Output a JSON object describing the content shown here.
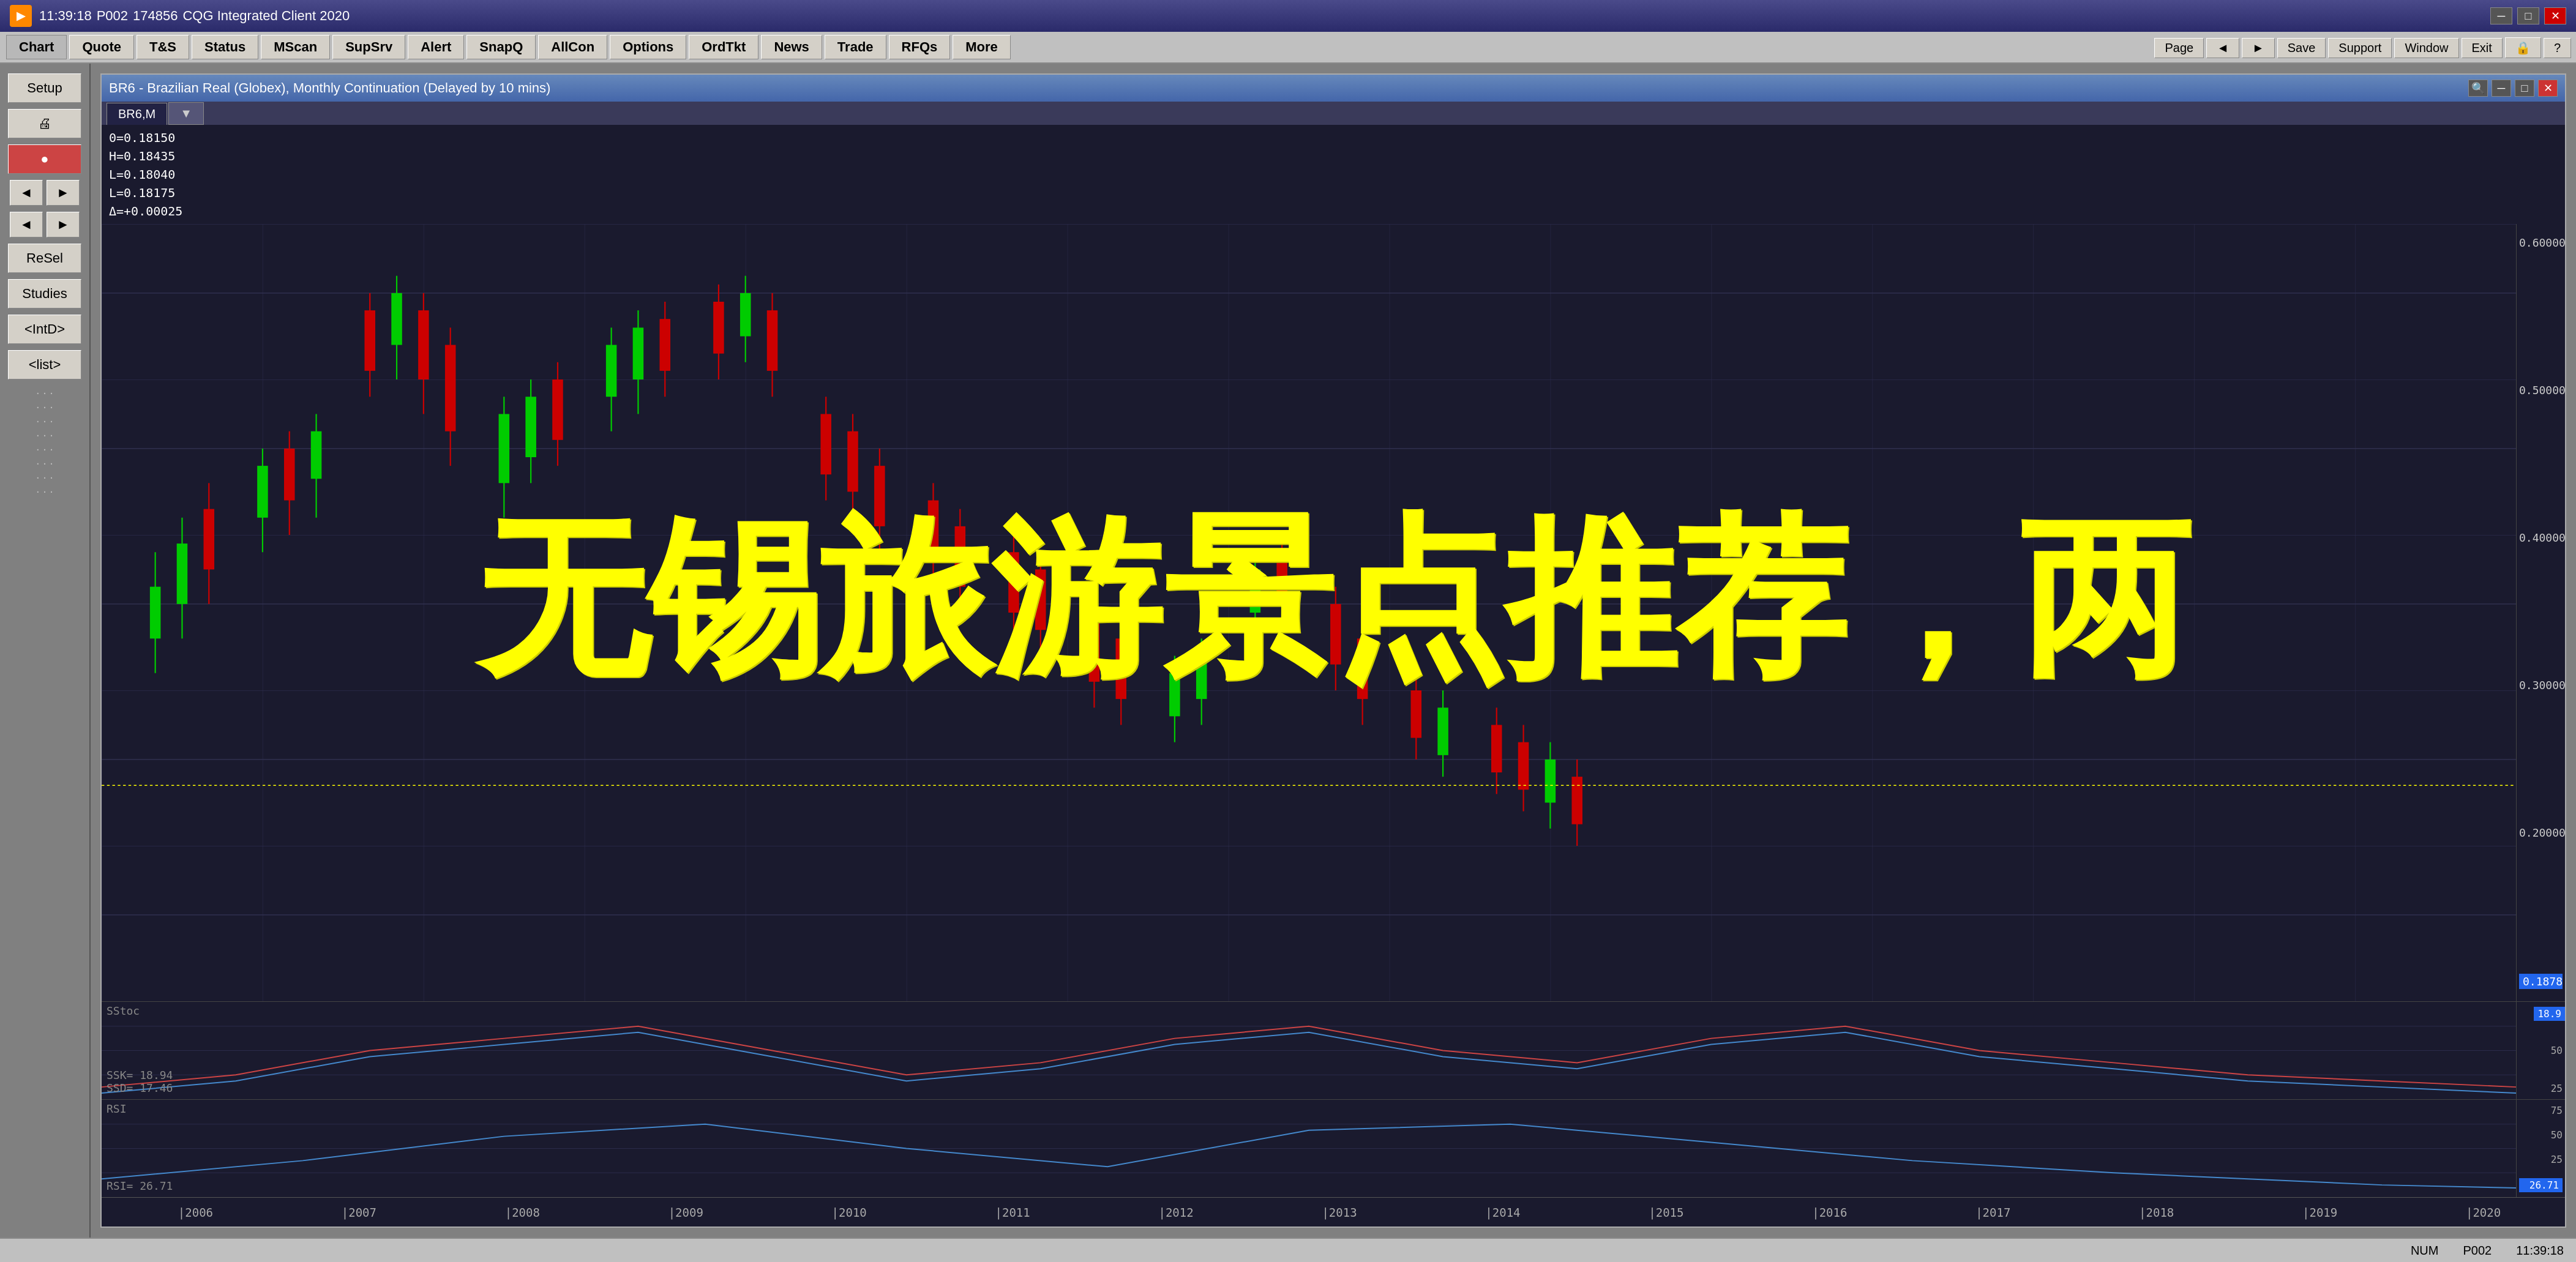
{
  "titlebar": {
    "icon_text": "▶",
    "time": "11:39:18",
    "account": "P002",
    "build": "174856",
    "app_name": "CQG Integrated Client 2020",
    "minimize": "─",
    "maximize": "□",
    "close": "✕"
  },
  "menubar": {
    "items": [
      {
        "label": "Chart",
        "active": true
      },
      {
        "label": "Quote"
      },
      {
        "label": "T&S"
      },
      {
        "label": "Status"
      },
      {
        "label": "MScan"
      },
      {
        "label": "SupSrv"
      },
      {
        "label": "Alert"
      },
      {
        "label": "SnapQ"
      },
      {
        "label": "AllCon"
      },
      {
        "label": "Options"
      },
      {
        "label": "OrdTkt"
      },
      {
        "label": "News"
      },
      {
        "label": "Trade"
      },
      {
        "label": "RFQs"
      },
      {
        "label": "More"
      }
    ]
  },
  "right_toolbar": {
    "items": [
      {
        "label": "Page"
      },
      {
        "label": "◄"
      },
      {
        "label": "►"
      },
      {
        "label": "Save"
      },
      {
        "label": "Support"
      },
      {
        "label": "Window"
      },
      {
        "label": "Exit"
      },
      {
        "label": "🔒"
      },
      {
        "label": "?"
      }
    ]
  },
  "sidebar": {
    "buttons": [
      {
        "label": "Setup"
      },
      {
        "label": "🖨"
      },
      {
        "label": "🔴"
      },
      {
        "label": "ReSel"
      },
      {
        "label": "Studies"
      },
      {
        "label": "<IntD>"
      },
      {
        "label": "<list>"
      }
    ],
    "icon_pairs": [
      {
        "left": "◄◄",
        "right": "►►"
      },
      {
        "left": "◄◄",
        "right": "►►"
      }
    ]
  },
  "chart": {
    "title": "BR6 - Brazilian Real (Globex), Monthly Continuation (Delayed by 10 mins)",
    "tabs": [
      "BR6,M",
      "▼"
    ],
    "info": {
      "open": "0=0.18150",
      "high": "H=0.18435",
      "low_1": "L=0.18040",
      "low_2": "L=0.18175",
      "delta": "Δ=+0.00025"
    },
    "price_levels": [
      "0.60000",
      "0.50000",
      "0.40000",
      "0.30000",
      "0.20000"
    ],
    "current_price": "0.1878",
    "stoch": {
      "label": "SStoc",
      "ssk_label": "SSK=",
      "ssk_value": "18.94",
      "ssd_label": "SSD=",
      "ssd_value": "17.46",
      "badge_value": "18.9"
    },
    "rsi": {
      "label": "RSI",
      "value_label": "RSI=",
      "value": "26.71",
      "badge_value": "26.71"
    },
    "time_labels": [
      "2006",
      "2007",
      "2008",
      "2009",
      "2010",
      "2011",
      "2012",
      "2013",
      "2014",
      "2015",
      "2016",
      "2017",
      "2018",
      "2019",
      "2020"
    ]
  },
  "overlay": {
    "text": "无锡旅游景点推荐，两"
  },
  "statusbar": {
    "num": "NUM",
    "account": "P002",
    "time": "11:39:18"
  },
  "chart_win_buttons": {
    "search": "🔍",
    "minimize": "─",
    "restore": "□",
    "close": "✕"
  }
}
